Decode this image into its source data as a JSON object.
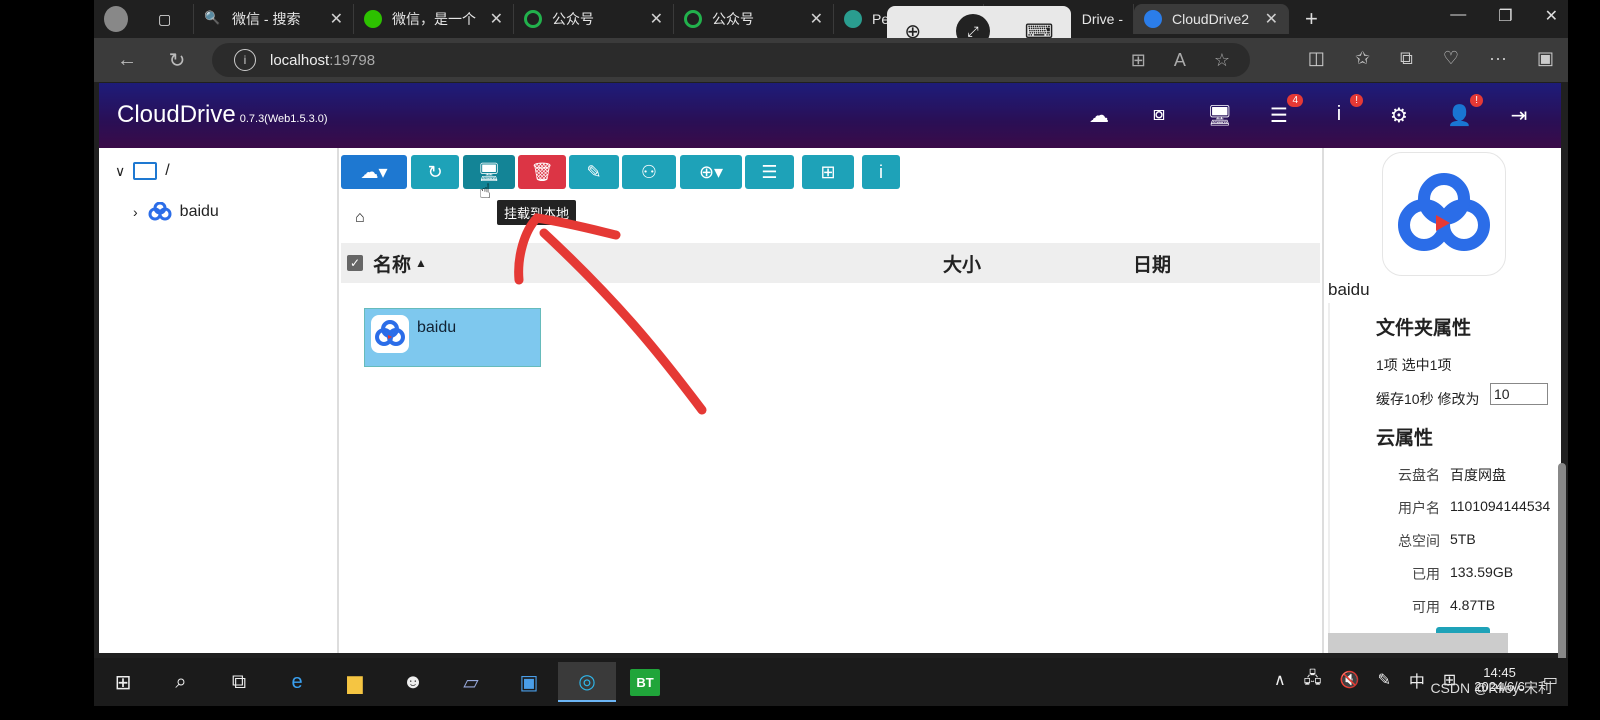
{
  "browser": {
    "tabs": [
      {
        "label": "",
        "icon": "profile-icon"
      },
      {
        "label": "",
        "icon": "tab-actions-icon"
      },
      {
        "label": "微信 - 搜索",
        "icon": "search-icon"
      },
      {
        "label": "微信，是一个",
        "icon": "wechat-icon"
      },
      {
        "label": "公众号",
        "icon": "miniprogram-icon"
      },
      {
        "label": "公众号",
        "icon": "miniprogram-icon"
      },
      {
        "label": "Pe",
        "icon": "globe-icon"
      },
      {
        "label": "Drive -",
        "icon": "cloud-icon"
      },
      {
        "label": "CloudDrive2",
        "icon": "clouddrive-icon"
      }
    ],
    "url_host": "localhost",
    "url_port": ":19798"
  },
  "app": {
    "brand": "CloudDrive",
    "version": "0.7.3(Web1.5.3.0)",
    "header_badges": {
      "tasks": "4",
      "info": "!",
      "user": "!"
    },
    "tree": {
      "root": "/",
      "child": "baidu"
    },
    "tooltip": "挂载到本地",
    "table": {
      "col_name": "名称",
      "col_size": "大小",
      "col_date": "日期"
    },
    "files": [
      {
        "name": "baidu"
      }
    ],
    "panel": {
      "name": "baidu",
      "folder_props_title": "文件夹属性",
      "count_text": "1项  选中1项",
      "cache_label": "缓存10秒  修改为",
      "cache_value": "10",
      "cloud_props_title": "云属性",
      "props": [
        {
          "k": "云盘名",
          "v": "百度网盘"
        },
        {
          "k": "用户名",
          "v": "1101094144534"
        },
        {
          "k": "总空间",
          "v": "5TB"
        },
        {
          "k": "已用",
          "v": "133.59GB"
        },
        {
          "k": "可用",
          "v": "4.87TB"
        }
      ]
    }
  },
  "taskbar": {
    "time": "14:45",
    "date": "2024/6/6",
    "ime": "中",
    "watermark": "CSDN @Riley-宋利",
    "bt_label": "BT"
  },
  "colors": {
    "header_from": "#1e1c7a",
    "header_to": "#3a0b48",
    "teal": "#1ea2b8",
    "red": "#dc3545",
    "blue": "#1e78d1"
  }
}
